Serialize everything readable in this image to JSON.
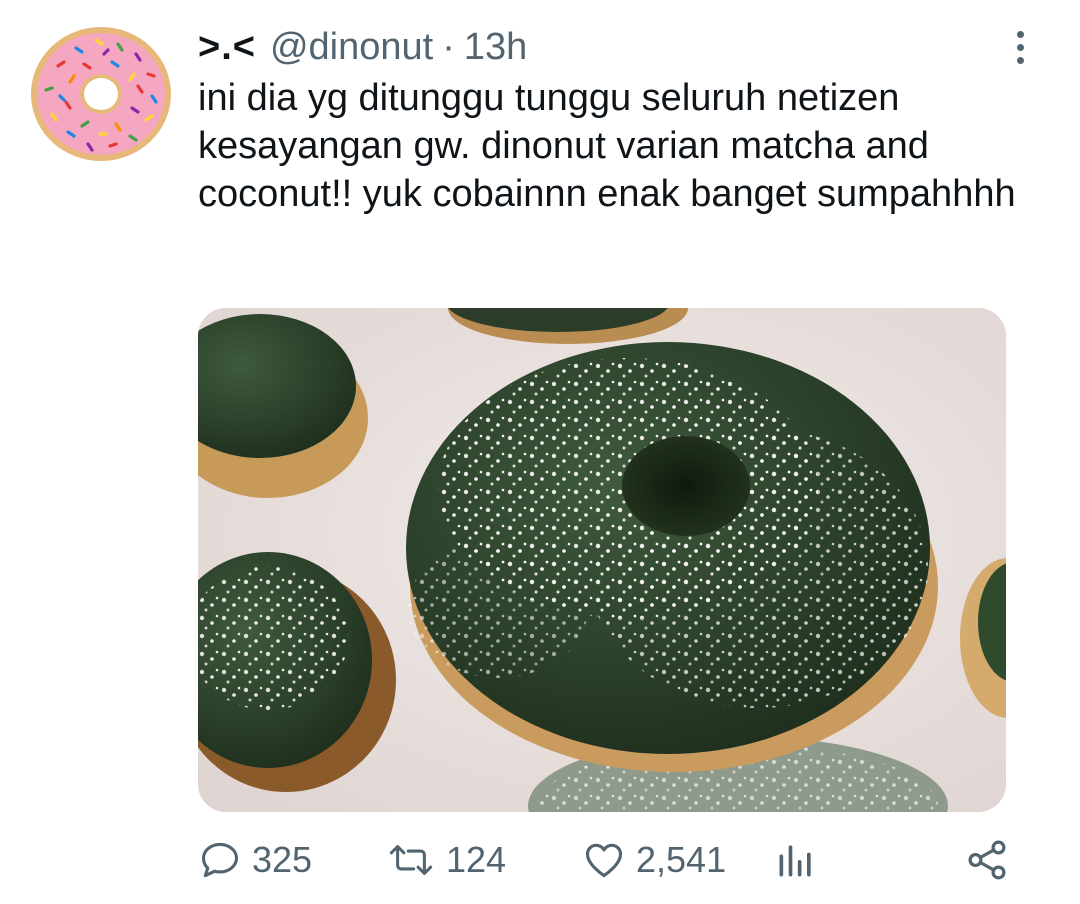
{
  "tweet": {
    "display_name": ">.<",
    "handle": "@dinonut",
    "separator": "·",
    "time": "13h",
    "text": "ini dia yg ditunggu tunggu seluruh netizen kesayangan gw. dinonut varian matcha and coconut!! yuk cobainnn enak banget sumpahhhh",
    "avatar": "pink-sprinkle-donut",
    "media": "matcha-coconut-donuts-photo"
  },
  "actions": {
    "replies": "325",
    "retweets": "124",
    "likes": "2,541"
  },
  "icons": {
    "reply": "reply-icon",
    "retweet": "retweet-icon",
    "like": "heart-icon",
    "analytics": "analytics-icon",
    "share": "share-icon",
    "more": "more-vertical-icon"
  },
  "colors": {
    "text": "#0f1419",
    "secondary": "#536471",
    "background": "#ffffff"
  }
}
